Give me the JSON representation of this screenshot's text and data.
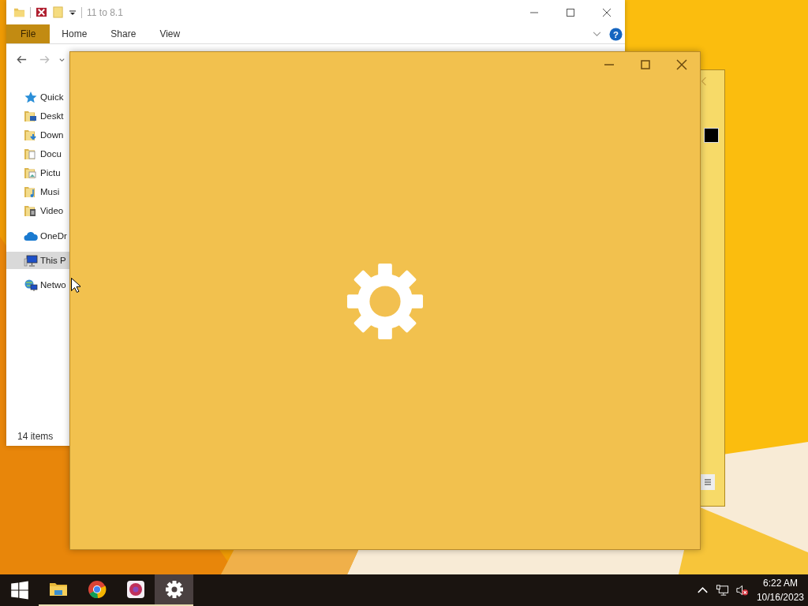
{
  "explorer": {
    "title": "11 to 8.1",
    "ribbon_tabs": [
      {
        "label": "File",
        "selected": true
      },
      {
        "label": "Home",
        "selected": false
      },
      {
        "label": "Share",
        "selected": false
      },
      {
        "label": "View",
        "selected": false
      }
    ],
    "nav_items": [
      {
        "label": "Quick",
        "kind": "star",
        "selected": false
      },
      {
        "label": "Deskt",
        "kind": "desktop",
        "selected": false
      },
      {
        "label": "Down",
        "kind": "downloads",
        "selected": false
      },
      {
        "label": "Docu",
        "kind": "documents",
        "selected": false
      },
      {
        "label": "Pictu",
        "kind": "pictures",
        "selected": false
      },
      {
        "label": "Musi",
        "kind": "music",
        "selected": false
      },
      {
        "label": "Video",
        "kind": "videos",
        "selected": false
      },
      {
        "label": "OneDr",
        "kind": "cloud",
        "selected": false
      },
      {
        "label": "This P",
        "kind": "pc",
        "selected": true
      },
      {
        "label": "Netwo",
        "kind": "network",
        "selected": false
      }
    ],
    "help_label": "?",
    "status_bar": "14 items"
  },
  "taskbar": {
    "apps": [
      {
        "kind": "explorer",
        "selected": false
      },
      {
        "kind": "chrome",
        "selected": false
      },
      {
        "kind": "app",
        "selected": false
      },
      {
        "kind": "settings",
        "selected": true
      }
    ],
    "time": "6:22 AM",
    "date": "10/16/2023"
  }
}
